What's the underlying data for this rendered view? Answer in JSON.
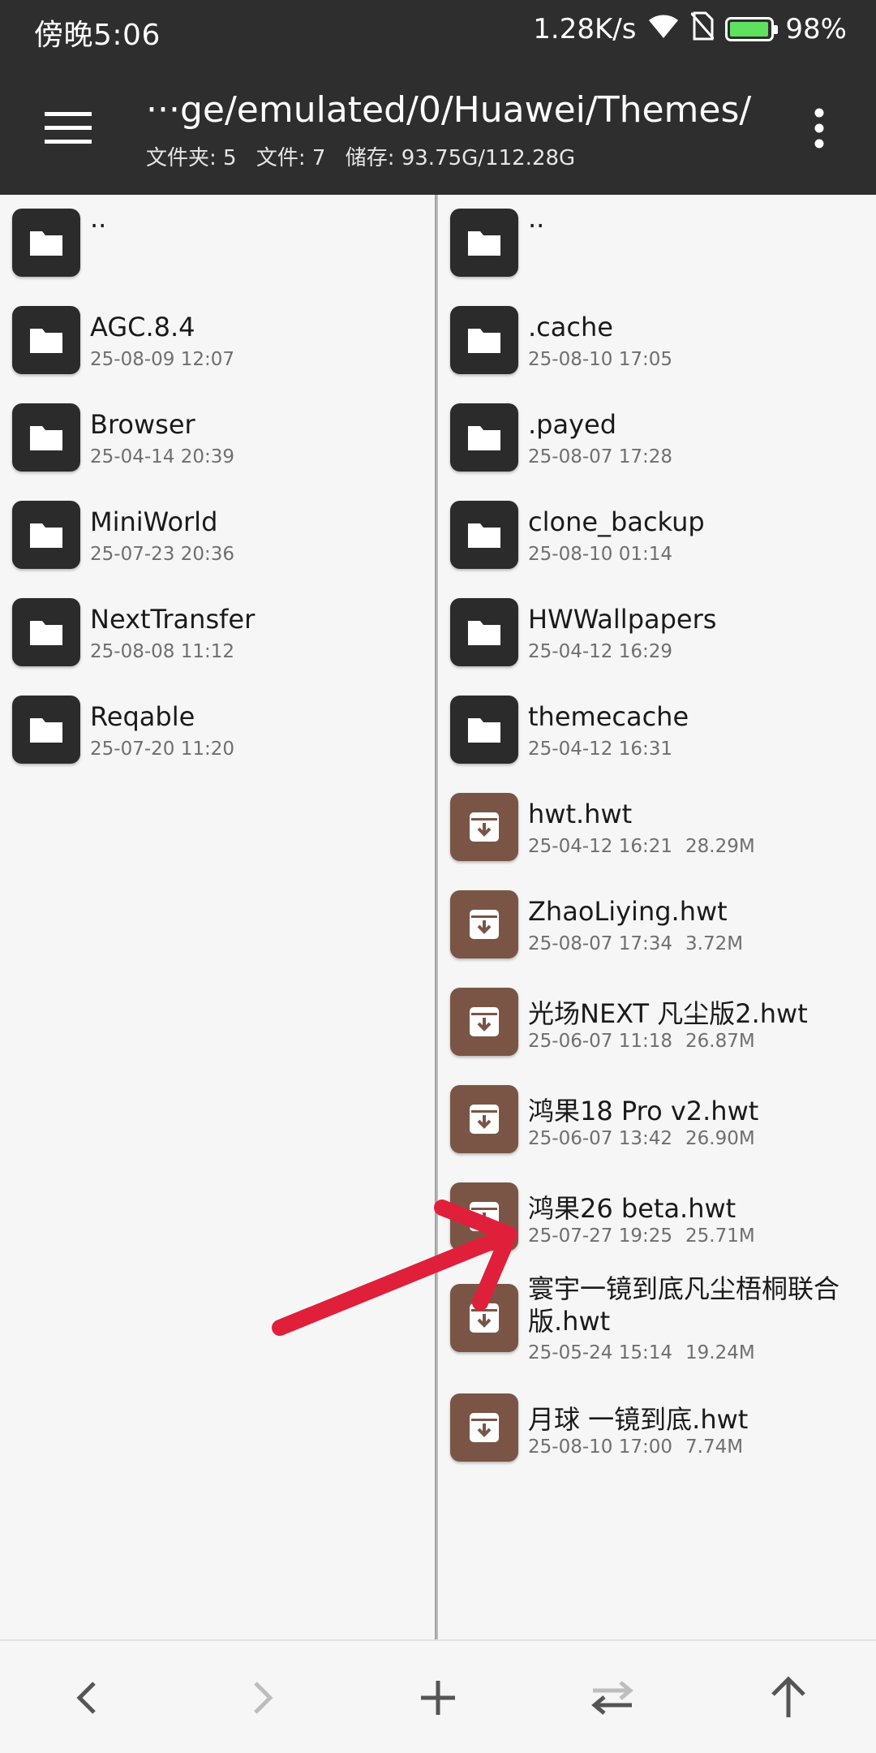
{
  "status_bar": {
    "time": "傍晚5:06",
    "speed": "1.28K/s",
    "battery": "98%",
    "battery_level": 0.98,
    "battery_color": "#5fe05f"
  },
  "app_bar": {
    "path": "···ge/emulated/0/Huawei/Themes/",
    "folders_label": "文件夹: 5",
    "files_label": "文件: 7",
    "storage_label": "储存: 93.75G/112.28G",
    "menu_icon": "hamburger-menu-icon",
    "more_icon": "more-vertical-icon"
  },
  "left_pane": {
    "items": [
      {
        "name": "..",
        "date": "",
        "size": ""
      },
      {
        "name": "AGC.8.4",
        "date": "25-08-09 12:07",
        "size": ""
      },
      {
        "name": "Browser",
        "date": "25-04-14 20:39",
        "size": ""
      },
      {
        "name": "MiniWorld",
        "date": "25-07-23 20:36",
        "size": ""
      },
      {
        "name": "NextTransfer",
        "date": "25-08-08 11:12",
        "size": ""
      },
      {
        "name": "Reqable",
        "date": "25-07-20 11:20",
        "size": ""
      }
    ]
  },
  "right_pane": {
    "items": [
      {
        "name": "..",
        "date": "",
        "size": ""
      },
      {
        "name": ".cache",
        "date": "25-08-10 17:05",
        "size": ""
      },
      {
        "name": ".payed",
        "date": "25-08-07 17:28",
        "size": ""
      },
      {
        "name": "clone_backup",
        "date": "25-08-10 01:14",
        "size": ""
      },
      {
        "name": "HWWallpapers",
        "date": "25-04-12 16:29",
        "size": ""
      },
      {
        "name": "themecache",
        "date": "25-04-12 16:31",
        "size": ""
      },
      {
        "name": "hwt.hwt",
        "date": "25-04-12 16:21",
        "size": "28.29M"
      },
      {
        "name": "ZhaoLiying.hwt",
        "date": "25-08-07 17:34",
        "size": "3.72M"
      },
      {
        "name": "光场NEXT 凡尘版2.hwt",
        "date": "25-06-07 11:18",
        "size": "26.87M"
      },
      {
        "name": "鸿果18 Pro v2.hwt",
        "date": "25-06-07 13:42",
        "size": "26.90M"
      },
      {
        "name": "鸿果26 beta.hwt",
        "date": "25-07-27 19:25",
        "size": "25.71M"
      },
      {
        "name": "寰宇一镜到底凡尘梧桐联合版.hwt",
        "date": "25-05-24 15:14",
        "size": "19.24M"
      },
      {
        "name": "月球 一镜到底.hwt",
        "date": "25-08-10 17:00",
        "size": "7.74M"
      }
    ]
  },
  "bottom_bar": {
    "buttons": [
      "back-icon",
      "forward-icon",
      "add-icon",
      "swap-icon",
      "up-icon"
    ]
  },
  "colors": {
    "bar_bg": "#2e2e2e",
    "folder_icon_bg": "#2b2b2b",
    "archive_icon_bg": "#7a5546",
    "annotation_red": "#e0203a"
  }
}
